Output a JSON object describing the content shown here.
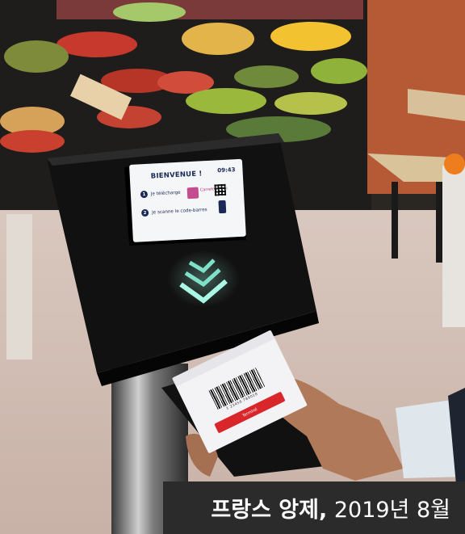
{
  "kiosk": {
    "title": "BIENVENUE !",
    "time": "09:43",
    "step1_num": "1",
    "step1": "Je télécharge",
    "step2_num": "2",
    "step2": "Je scanne le code-barres",
    "app_brand": "Carrefour Moi"
  },
  "phone": {
    "code": "1 23456 789018",
    "button": "Terminé"
  },
  "caption": {
    "bold": "프랑스 앙제,",
    "normal": " 2019년 8월"
  },
  "colors": {
    "caption_bg": "#2b2b2b",
    "caption_text": "#ffffff",
    "arrow_glow": "#7fe0c8",
    "kiosk_body": "#111111"
  }
}
